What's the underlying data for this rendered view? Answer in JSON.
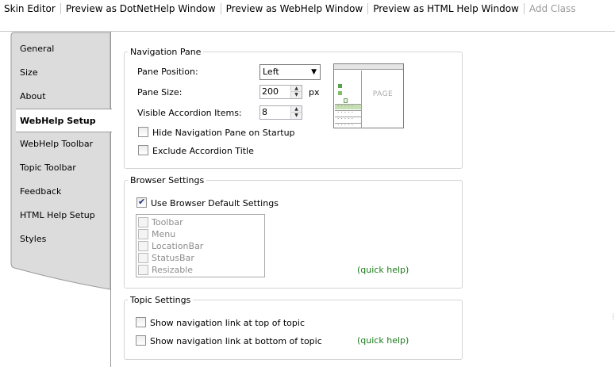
{
  "toolbar": {
    "items": [
      "Skin Editor",
      "Preview as DotNetHelp Window",
      "Preview as WebHelp Window",
      "Preview as HTML Help Window",
      "Add Class"
    ]
  },
  "tabs": [
    "General",
    "Size",
    "About",
    "WebHelp Setup",
    "WebHelp Toolbar",
    "Topic Toolbar",
    "Feedback",
    "HTML Help Setup",
    "Styles"
  ],
  "active_tab": "WebHelp Setup",
  "navigation_pane": {
    "title": "Navigation Pane",
    "pane_position_label": "Pane Position:",
    "pane_position_value": "Left",
    "pane_size_label": "Pane Size:",
    "pane_size_value": "200",
    "pane_size_unit": "px",
    "visible_items_label": "Visible Accordion Items:",
    "visible_items_value": "8",
    "hide_on_startup_label": "Hide Navigation Pane on Startup",
    "hide_on_startup_checked": false,
    "exclude_title_label": "Exclude Accordion Title",
    "exclude_title_checked": false,
    "preview_page_text": "PAGE"
  },
  "browser_settings": {
    "title": "Browser Settings",
    "use_default_label": "Use Browser Default Settings",
    "use_default_checked": true,
    "options": [
      "Toolbar",
      "Menu",
      "LocationBar",
      "StatusBar",
      "Resizable"
    ],
    "quick_help": "(quick help)"
  },
  "topic_settings": {
    "title": "Topic Settings",
    "nav_top_label": "Show navigation link at top of topic",
    "nav_bottom_label": "Show navigation link at bottom of topic",
    "quick_help": "(quick help)"
  },
  "colors": {
    "quick_help": "#1a7a1a",
    "disabled_text": "#8d8d8d",
    "tab_panel": "#dcdcdc"
  }
}
